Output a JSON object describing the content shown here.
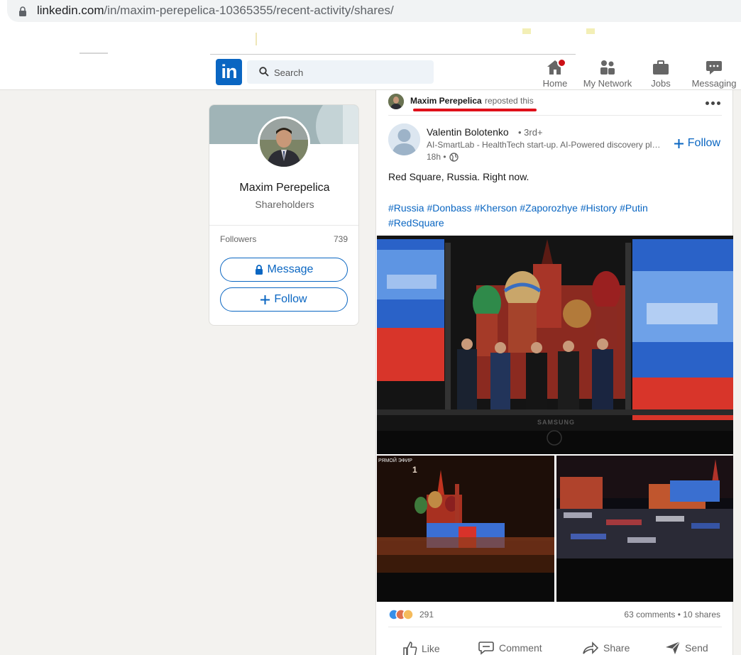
{
  "browser": {
    "url_host": "linkedin.com",
    "url_path": "/in/maxim-perepelica-10365355/recent-activity/shares/"
  },
  "nav": {
    "search_placeholder": "Search",
    "items": [
      {
        "label": "Home",
        "icon": "home-icon"
      },
      {
        "label": "My Network",
        "icon": "network-icon"
      },
      {
        "label": "Jobs",
        "icon": "briefcase-icon"
      },
      {
        "label": "Messaging",
        "icon": "chat-icon"
      }
    ],
    "logo": "in"
  },
  "profile": {
    "name": "Maxim Perepelica",
    "headline": "Shareholders",
    "followers_label": "Followers",
    "followers_count": "739",
    "message_label": "Message",
    "follow_label": "Follow"
  },
  "post": {
    "reposter": "Maxim Perepelica",
    "repost_action": "reposted this",
    "author_name": "Valentin Bolotenko",
    "author_degree": "• 3rd+",
    "author_headline": "AI-SmartLab - HealthTech start-up. AI-Powered discovery platform",
    "time": "18h •",
    "follow_label": "Follow",
    "text": "Red Square, Russia. Right now.",
    "hashtags": [
      "#Russia",
      "#Donbass",
      "#Kherson",
      "#Zaporozhye",
      "#History",
      "#Putin",
      "#RedSquare"
    ],
    "reaction_count": "291",
    "stats": "63 comments • 10 shares",
    "actions": [
      {
        "label": "Like",
        "icon": "like-icon"
      },
      {
        "label": "Comment",
        "icon": "comment-icon"
      },
      {
        "label": "Share",
        "icon": "share-icon"
      },
      {
        "label": "Send",
        "icon": "send-icon"
      }
    ],
    "image_captions": {
      "tv_brand": "SAMSUNG",
      "live_label": "РЯМОЙ ЭФИР"
    }
  },
  "colors": {
    "brand_blue": "#0a66c2",
    "annotation_red": "#e0101a",
    "page_bg": "#f3f2ef"
  }
}
